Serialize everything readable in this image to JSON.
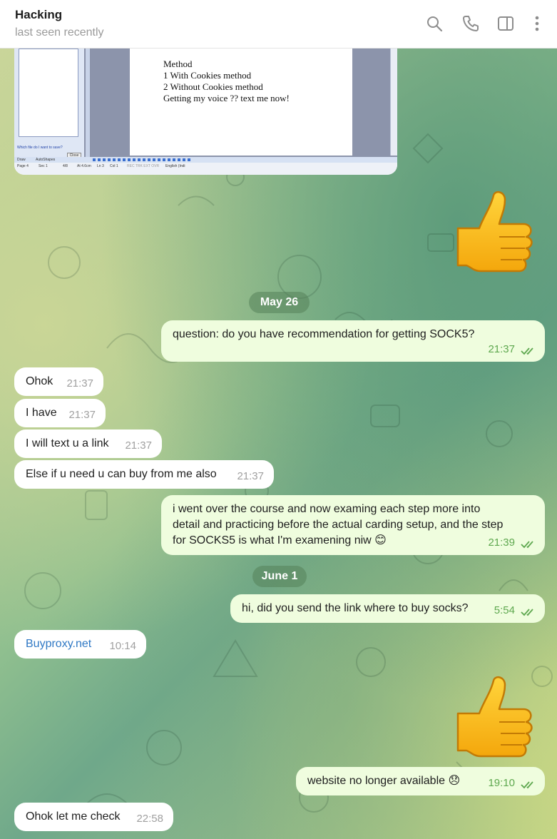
{
  "header": {
    "title": "Hacking",
    "status": "last seen recently",
    "icons": [
      "search-icon",
      "phone-icon",
      "sidebar-icon",
      "more-icon"
    ]
  },
  "screenshot": {
    "doc_lines": [
      "Method",
      "1 With  Cookies method",
      "2 Without Cookies method",
      "Getting my voice ?? text me now!"
    ],
    "sidebar_hint": "Which file do I want to save?",
    "close_label": "Close",
    "toolbar_draw": "Draw",
    "toolbar_autoshapes": "AutoShapes",
    "status_page": "Page 4",
    "status_sec": "Sec 1",
    "status_pages": "4/8",
    "status_at": "At 4.6cm",
    "status_ln": "Ln 3",
    "status_col": "Col 1",
    "status_modes": "REC  TRK  EXT  OVR",
    "status_lang": "English (Indi"
  },
  "dates": {
    "may26": "May 26",
    "june1": "June 1"
  },
  "messages": {
    "m1": {
      "text": "question: do you have recommendation for getting SOCK5?",
      "time": "21:37"
    },
    "m2": {
      "text": "Ohok",
      "time": "21:37"
    },
    "m3": {
      "text": "I have",
      "time": "21:37"
    },
    "m4": {
      "text": "I will text u a link",
      "time": "21:37"
    },
    "m5": {
      "text": "Else if u need u can buy from me also",
      "time": "21:37"
    },
    "m6": {
      "line1": "i went over the course and now examing each step more into",
      "line2": "detail and practicing before the actual carding setup, and the step",
      "line3": "for SOCKS5 is what I'm examening niw 😊",
      "time": "21:39"
    },
    "m7": {
      "text": "hi, did you send the link where to buy socks?",
      "time": "5:54"
    },
    "m8": {
      "text": "Buyproxy.net",
      "time": "10:14"
    },
    "m9": {
      "text": "website no longer available 😞",
      "time": "19:10"
    },
    "m10": {
      "text": "Ohok let me check",
      "time": "22:58"
    }
  },
  "stickers": [
    "thumbs-up",
    "thumbs-up"
  ],
  "colors": {
    "incoming": "#ffffff",
    "outgoing": "#effdde",
    "outgoing_time": "#5ea84f",
    "link": "#2f78c4",
    "date_pill": "#6f9a6a"
  }
}
